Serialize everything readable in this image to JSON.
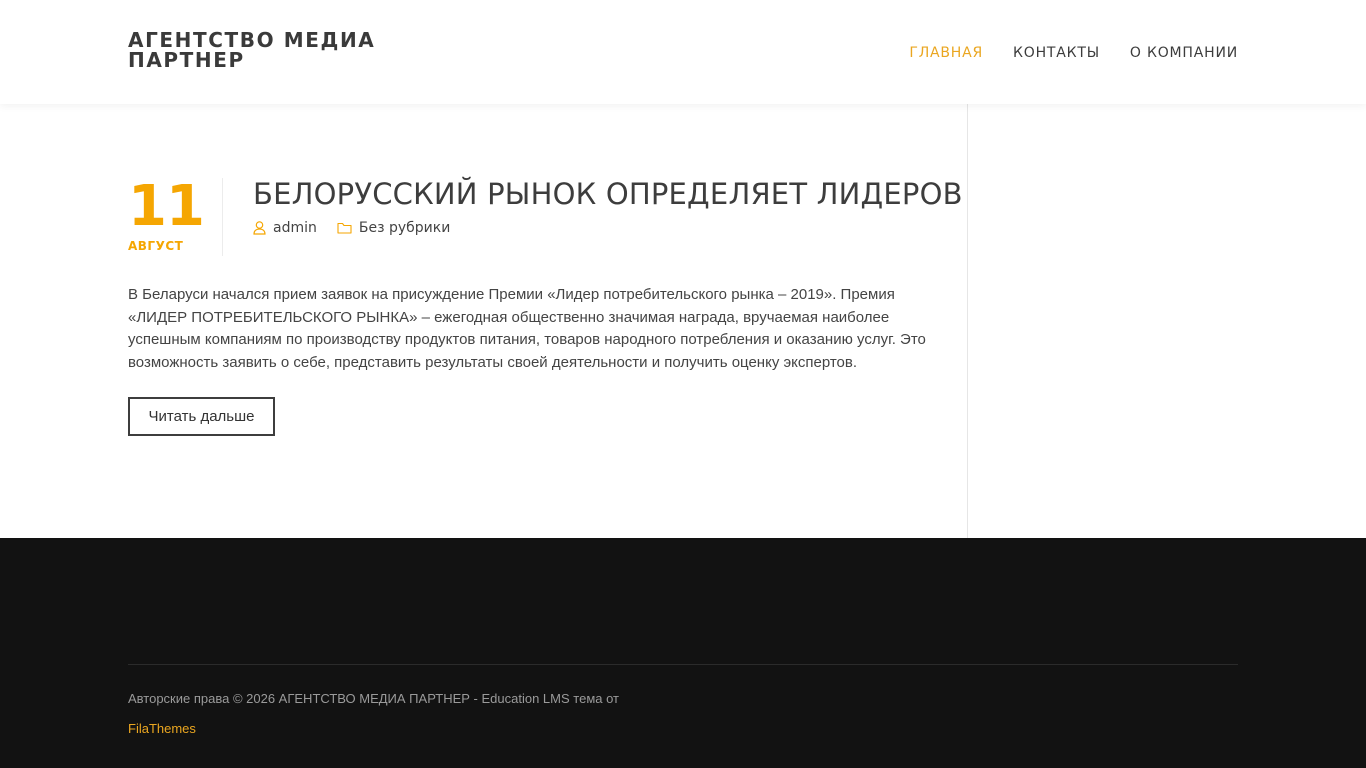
{
  "site": {
    "logo_line1": "АГЕНТСТВО МЕДИА",
    "logo_line2": "ПАРТНЕР"
  },
  "nav": {
    "items": [
      {
        "label": "ГЛАВНАЯ",
        "active": true
      },
      {
        "label": "КОНТАКТЫ",
        "active": false
      },
      {
        "label": "О КОМПАНИИ",
        "active": false
      }
    ]
  },
  "post": {
    "day": "11",
    "month": "АВГУСТ",
    "title": "БЕЛОРУССКИЙ РЫНОК ОПРЕДЕЛЯЕТ ЛИДЕРОВ",
    "author": "admin",
    "author_icon": "user-icon",
    "category": "Без рубрики",
    "category_icon": "folder-icon",
    "excerpt": "В Беларуси начался прием заявок на присуждение Премии «Лидер потребительского рынка – 2019». Премия «ЛИДЕР ПОТРЕБИТЕЛЬСКОГО РЫНКА» – ежегодная общественно значимая награда, вручаемая наиболее успешным компаниям по производству продуктов питания, товаров народного потребления и оказанию услуг. Это возможность заявить о себе, представить результаты своей деятельности и получить оценку экспертов.",
    "read_more": "Читать дальше"
  },
  "footer": {
    "copyright": "Авторские права © 2026 АГЕНТСТВО МЕДИА ПАРТНЕР - Education LMS тема от",
    "credit": "FilaThemes"
  },
  "colors": {
    "accent": "#f5a602",
    "footer_bg": "#121212",
    "text": "#444444"
  }
}
